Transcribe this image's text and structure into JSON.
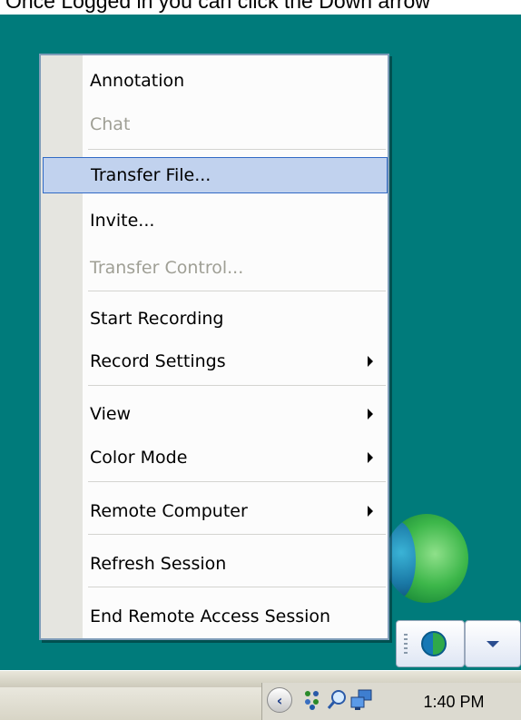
{
  "caption": "Once Logged in you can click the Down arrow",
  "context_menu": {
    "items": [
      {
        "label": "Annotation",
        "state": "normal",
        "submenu": false
      },
      {
        "label": "Chat",
        "state": "disabled",
        "submenu": false
      },
      {
        "label": "Transfer File...",
        "state": "highlighted",
        "submenu": false
      },
      {
        "label": "Invite...",
        "state": "normal",
        "submenu": false
      },
      {
        "label": "Transfer Control...",
        "state": "disabled",
        "submenu": false
      },
      {
        "label": "Start Recording",
        "state": "normal",
        "submenu": false
      },
      {
        "label": "Record Settings",
        "state": "normal",
        "submenu": true
      },
      {
        "label": "View",
        "state": "normal",
        "submenu": true
      },
      {
        "label": "Color Mode",
        "state": "normal",
        "submenu": true
      },
      {
        "label": "Remote Computer",
        "state": "normal",
        "submenu": true
      },
      {
        "label": "Refresh Session",
        "state": "normal",
        "submenu": false
      },
      {
        "label": "End Remote Access Session",
        "state": "normal",
        "submenu": false
      }
    ]
  },
  "tray": {
    "clock": "1:40 PM",
    "icons": [
      "show-hidden-icons-chevron-icon",
      "network-icon",
      "search-icon",
      "computer-icon"
    ]
  },
  "notification_buttons": {
    "icons": [
      "globe-app-icon",
      "dropdown-arrow-icon"
    ]
  },
  "colors": {
    "desktop": "#007b7b",
    "menu_highlight": "#c1d2ee",
    "menu_highlight_border": "#316ac5",
    "disabled_text": "#9f9f95"
  }
}
